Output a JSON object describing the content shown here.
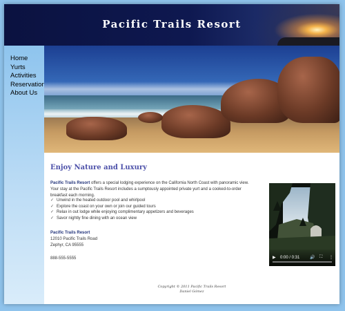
{
  "site": {
    "title": "Pacific Trails Resort"
  },
  "nav": {
    "items": [
      {
        "label": "Home"
      },
      {
        "label": "Yurts"
      },
      {
        "label": "Activities"
      },
      {
        "label": "Reservation"
      },
      {
        "label": "About Us"
      }
    ]
  },
  "content": {
    "heading": "Enjoy Nature and Luxury",
    "intro_brand": "Pacific Trails Resort",
    "intro_text": " offers a special lodging experience on the California North Coast with panoramic view. Your stay at the Pacific Trails Resort includes a sumptously appointed private yurt and a cooked-to-order breakfast each morning.",
    "amenities": [
      {
        "text": "Unwind in the heated outdoor pool and whirlpool"
      },
      {
        "text": "Explore the coast on your own or join our guided tours"
      },
      {
        "text": "Relax in out lodge while enjoying complimentary appetizers and beverages"
      },
      {
        "text": "Savor nightly fine dining with an ocean view"
      }
    ],
    "amenity_icon": "check-bullet-icon",
    "address": {
      "name": "Pacific Trails Resort",
      "street": "12010 Pacific Trails Road",
      "city": "Zephyr, CA 95555"
    },
    "phone": "888-555-5555"
  },
  "video": {
    "time": "0:00 / 0:31",
    "progress": 0,
    "icons": [
      "play-icon",
      "volume-icon",
      "fullscreen-icon",
      "more-icon"
    ]
  },
  "footer": {
    "copyright": "Copyright © 2011 Pacific Trails Resort",
    "author": "Daniel Gómez"
  },
  "colors": {
    "heading": "#4b4fa8",
    "brand_text": "#22337a",
    "page_background": "#8fc3ec",
    "header_navy": "#0b1240"
  }
}
